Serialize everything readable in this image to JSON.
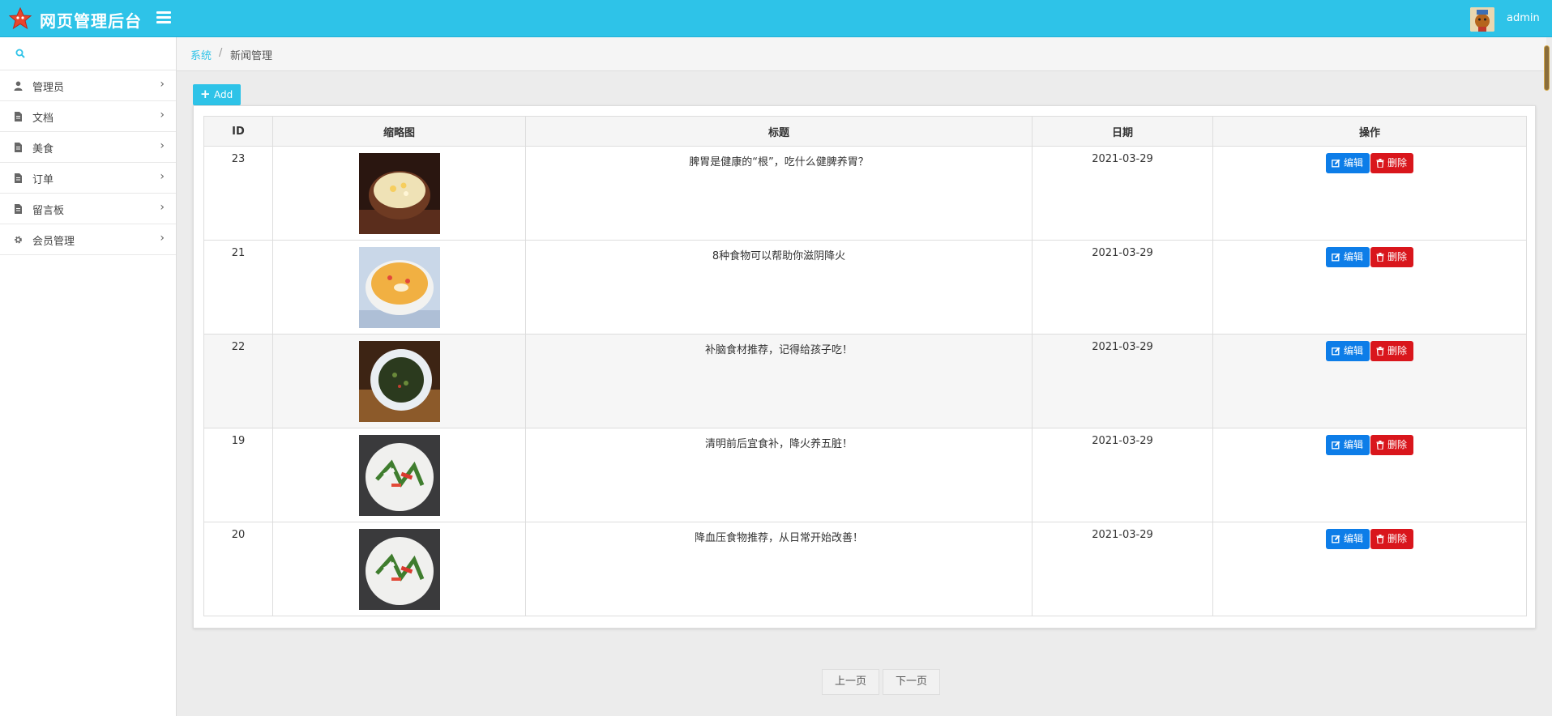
{
  "app": {
    "title": "网页管理后台",
    "username": "admin"
  },
  "sidebar": {
    "items": [
      {
        "label": "管理员",
        "icon": "user-icon"
      },
      {
        "label": "文档",
        "icon": "file-icon"
      },
      {
        "label": "美食",
        "icon": "file-icon"
      },
      {
        "label": "订单",
        "icon": "file-icon"
      },
      {
        "label": "留言板",
        "icon": "file-icon"
      },
      {
        "label": "会员管理",
        "icon": "gear-icon"
      }
    ]
  },
  "breadcrumb": {
    "root": "系统",
    "separator": "/",
    "current": "新闻管理"
  },
  "toolbar": {
    "add_label": "Add"
  },
  "table": {
    "headers": {
      "id": "ID",
      "thumb": "缩略图",
      "title": "标题",
      "date": "日期",
      "actions": "操作"
    },
    "rows": [
      {
        "id": "23",
        "title": "脾胃是健康的“根”，吃什么健脾养胃？",
        "date": "2021-03-29",
        "thumb": "soup-bowl"
      },
      {
        "id": "21",
        "title": "8种食物可以帮助你滋阴降火",
        "date": "2021-03-29",
        "thumb": "dessert-bowl"
      },
      {
        "id": "22",
        "title": "补脑食材推荐，记得给孩子吃！",
        "date": "2021-03-29",
        "thumb": "seaweed-plate"
      },
      {
        "id": "19",
        "title": "清明前后宜食补，降火养五脏！",
        "date": "2021-03-29",
        "thumb": "salad-plate"
      },
      {
        "id": "20",
        "title": "降血压食物推荐，从日常开始改善！",
        "date": "2021-03-29",
        "thumb": "salad-plate"
      }
    ],
    "edit_label": "编辑",
    "delete_label": "删除"
  },
  "pagination": {
    "prev_label": "上一页",
    "next_label": "下一页"
  },
  "colors": {
    "accent": "#2ec3e8",
    "edit": "#0d7de8",
    "delete": "#d9161c"
  }
}
